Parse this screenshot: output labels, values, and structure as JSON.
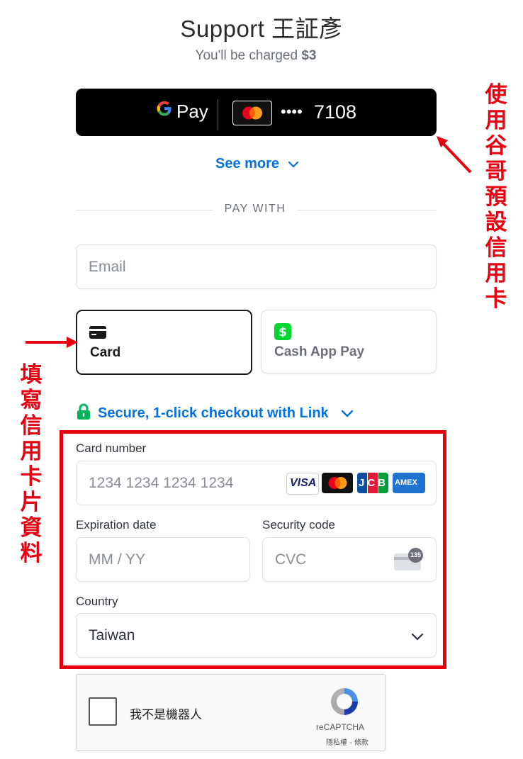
{
  "header": {
    "title": "Support 王証彥",
    "charge_prefix": "You'll be charged ",
    "charge_amount": "$3"
  },
  "gpay": {
    "g_letter": "G",
    "pay_label": "Pay",
    "dots": "••••",
    "last4": "7108"
  },
  "see_more": {
    "label": "See more"
  },
  "divider": {
    "label": "PAY WITH"
  },
  "email": {
    "placeholder": "Email"
  },
  "tabs": [
    {
      "label": "Card",
      "icon": "credit-card-icon",
      "selected": true
    },
    {
      "label": "Cash App Pay",
      "icon": "cash-app-icon",
      "selected": false
    }
  ],
  "link_checkout": {
    "label": "Secure, 1-click checkout with Link"
  },
  "card_form": {
    "card_number_label": "Card number",
    "card_number_placeholder": "1234 1234 1234 1234",
    "expiry_label": "Expiration date",
    "expiry_placeholder": "MM / YY",
    "security_label": "Security code",
    "security_placeholder": "CVC",
    "cvc_badge": "135",
    "country_label": "Country",
    "country_value": "Taiwan",
    "brands": [
      "VISA",
      "JCB",
      "AMEX"
    ]
  },
  "recaptcha": {
    "label": "我不是機器人",
    "brand": "reCAPTCHA",
    "links": "隱私權 - 條款"
  },
  "annotations": {
    "right_text": "使用谷哥預設信用卡",
    "left_text": "填寫信用卡片資料",
    "color": "#e60012"
  },
  "colors": {
    "accent": "#0570de",
    "link_green": "#00d66f",
    "cash_green": "#00d632"
  }
}
